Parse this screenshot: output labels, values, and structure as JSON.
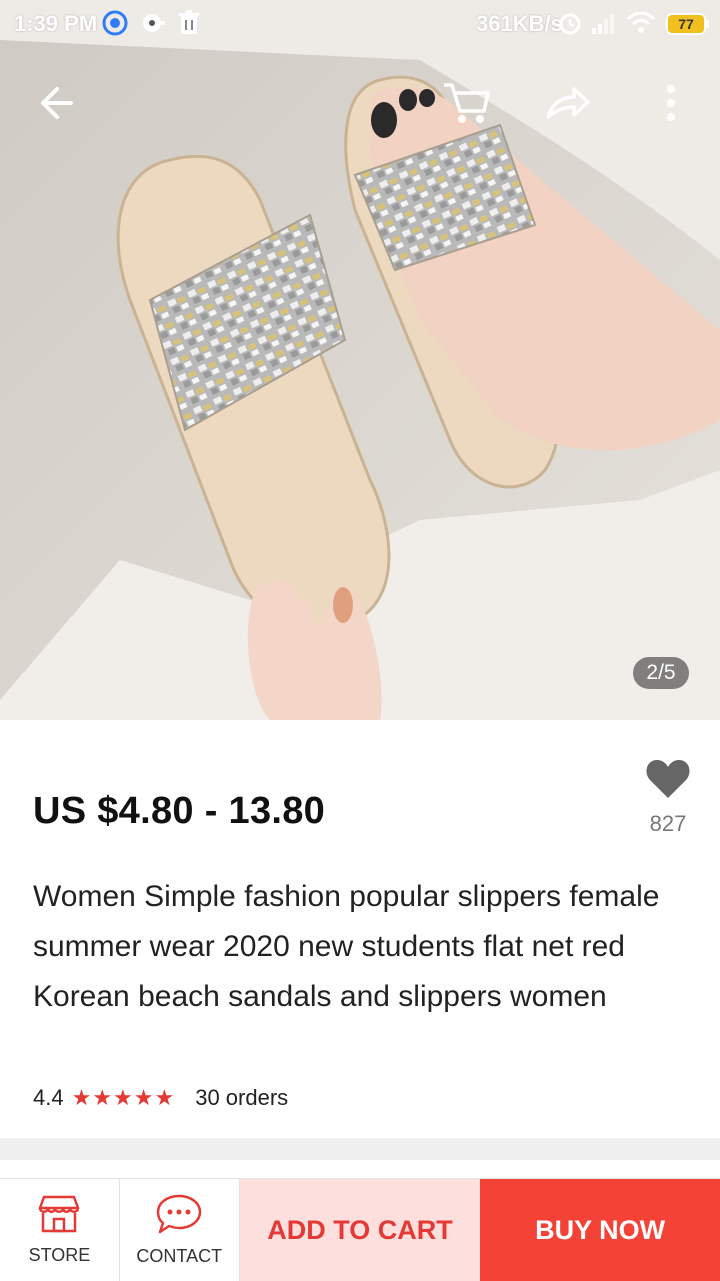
{
  "status_bar": {
    "time": "1:39 PM",
    "network_speed": "361KB/s",
    "battery": "77"
  },
  "gallery": {
    "page_indicator": "2/5"
  },
  "product": {
    "price": "US $4.80 - 13.80",
    "wishlist_count": "827",
    "title": "Women Simple fashion popular slippers female summer wear 2020 new students flat net red Korean beach sandals and slippers women",
    "rating": "4.4",
    "stars": "★★★★★",
    "orders": "30 orders"
  },
  "bottom_bar": {
    "store_label": "STORE",
    "contact_label": "CONTACT",
    "add_to_cart_label": "ADD TO CART",
    "buy_now_label": "BUY NOW"
  },
  "colors": {
    "accent": "#f44336",
    "accent_light": "#fde0de",
    "star": "#e53935"
  }
}
